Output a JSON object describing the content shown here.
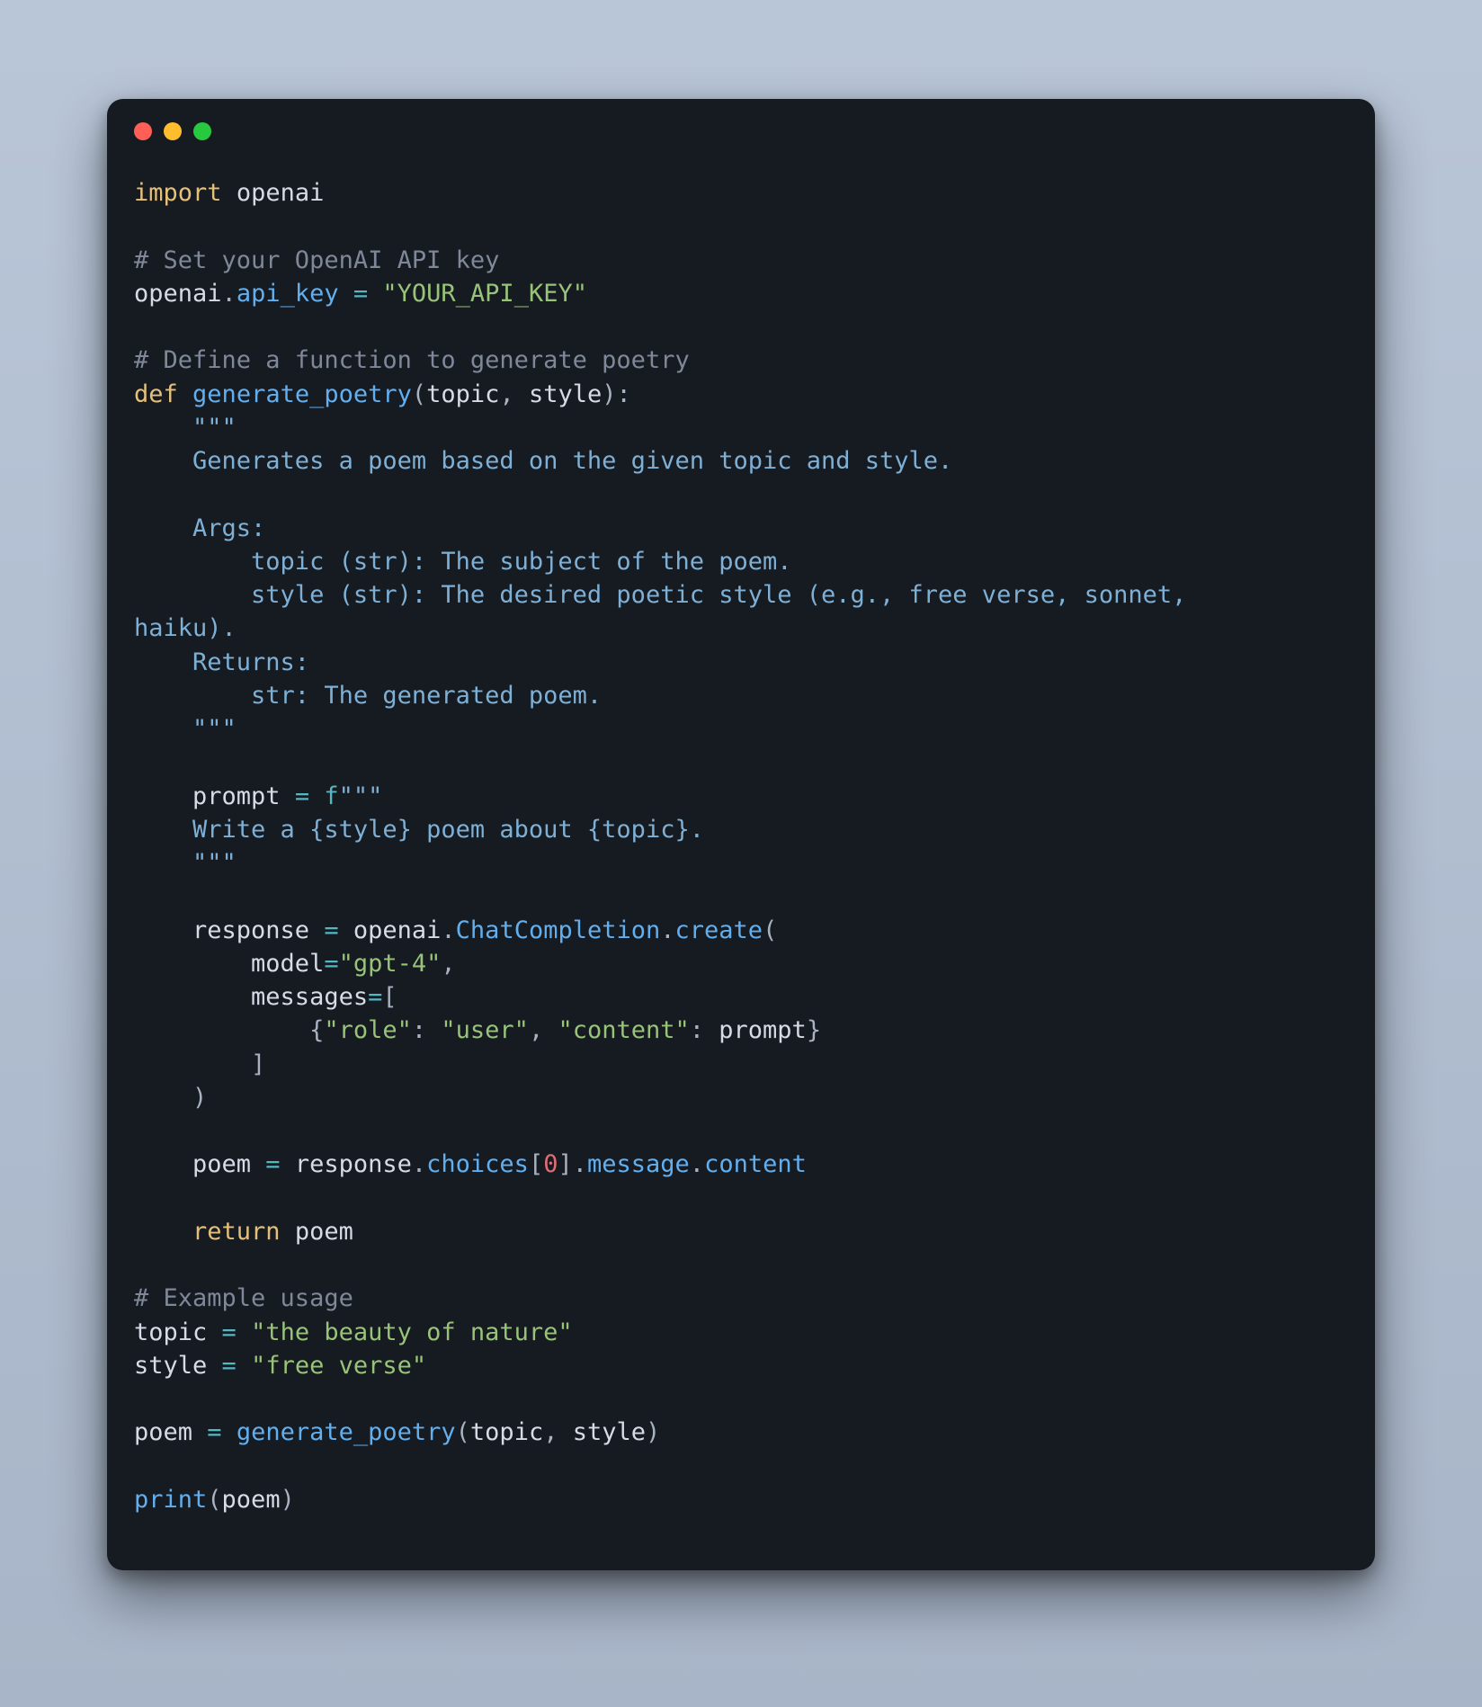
{
  "code": {
    "l01_import": "import",
    "l01_openai": "openai",
    "l03_comment": "# Set your OpenAI API key",
    "l04_openai": "openai",
    "l04_dot": ".",
    "l04_apikey": "api_key",
    "l04_eq": " = ",
    "l04_str": "\"YOUR_API_KEY\"",
    "l06_comment": "# Define a function to generate poetry",
    "l07_def": "def",
    "l07_fn": "generate_poetry",
    "l07_open": "(",
    "l07_p1": "topic",
    "l07_comma": ", ",
    "l07_p2": "style",
    "l07_close": "):",
    "doc_open": "    \"\"\"",
    "doc_l1": "    Generates a poem based on the given topic and style.",
    "doc_blank": "",
    "doc_args": "    Args:",
    "doc_arg1": "        topic (str): The subject of the poem.",
    "doc_arg2": "        style (str): The desired poetic style (e.g., free verse, sonnet, ",
    "doc_arg2b": "haiku).",
    "doc_ret": "    Returns:",
    "doc_ret1": "        str: The generated poem.",
    "doc_close": "    \"\"\"",
    "p_prompt": "    prompt",
    "p_eq": " = ",
    "p_f": "f",
    "p_tq": "\"\"\"",
    "p_body": "    Write a {style} poem about {topic}.",
    "p_tq2": "    \"\"\"",
    "r_resp": "    response",
    "r_eq": " = ",
    "r_openai": "openai",
    "r_dot1": ".",
    "r_cc": "ChatCompletion",
    "r_dot2": ".",
    "r_create": "create",
    "r_open": "(",
    "m_model_k": "        model",
    "m_model_eq": "=",
    "m_model_v": "\"gpt-4\"",
    "m_model_c": ",",
    "m_msgs_k": "        messages",
    "m_msgs_eq": "=",
    "m_msgs_open": "[",
    "m_item_open": "            {",
    "m_role_k": "\"role\"",
    "m_colon1": ": ",
    "m_role_v": "\"user\"",
    "m_comma": ", ",
    "m_content_k": "\"content\"",
    "m_colon2": ": ",
    "m_content_v": "prompt",
    "m_item_close": "}",
    "m_msgs_close": "        ]",
    "r_close": "    )",
    "poem_l": "    poem",
    "poem_eq": " = ",
    "poem_resp": "response",
    "poem_dot1": ".",
    "poem_choices": "choices",
    "poem_br_o": "[",
    "poem_idx": "0",
    "poem_br_c": "]",
    "poem_dot2": ".",
    "poem_msg": "message",
    "poem_dot3": ".",
    "poem_content": "content",
    "ret_kw": "    return",
    "ret_val": " poem",
    "ex_comment": "# Example usage",
    "ex_topic": "topic",
    "ex_topic_eq": " = ",
    "ex_topic_v": "\"the beauty of nature\"",
    "ex_style": "style",
    "ex_style_eq": " = ",
    "ex_style_v": "\"free verse\"",
    "call_poem": "poem",
    "call_eq": " = ",
    "call_fn": "generate_poetry",
    "call_open": "(",
    "call_a1": "topic",
    "call_comma": ", ",
    "call_a2": "style",
    "call_close": ")",
    "pr_fn": "print",
    "pr_open": "(",
    "pr_arg": "poem",
    "pr_close": ")"
  }
}
